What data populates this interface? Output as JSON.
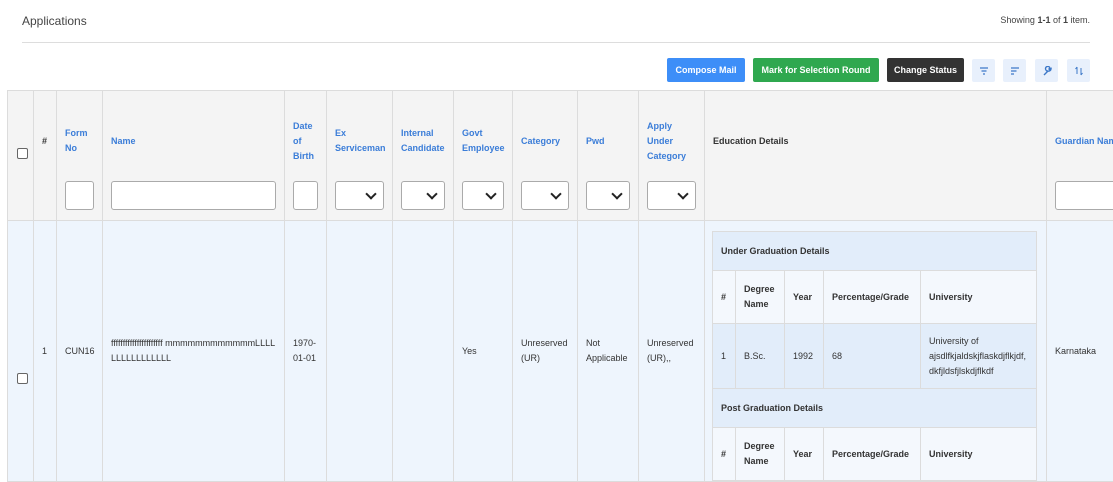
{
  "page": {
    "title": "Applications",
    "summary_prefix": "Showing ",
    "summary_range": "1-1",
    "summary_of": " of ",
    "summary_total": "1",
    "summary_suffix": " item."
  },
  "toolbar": {
    "compose_mail": "Compose Mail",
    "mark_selection": "Mark for Selection Round",
    "change_status": "Change Status"
  },
  "columns": {
    "num": "#",
    "form_no": "Form No",
    "name": "Name",
    "dob": "Date of Birth",
    "ex_serviceman": "Ex Serviceman",
    "internal_candidate": "Internal Candidate",
    "govt_employee": "Govt Employee",
    "category": "Category",
    "pwd": "Pwd",
    "apply_under_category": "Apply Under Category",
    "education_details": "Education Details",
    "guardian_name": "Guardian Name"
  },
  "row": {
    "num": "1",
    "form_no": "CUN16",
    "name": "ffffffffffffffffffffff mmmmmmmmmmmmLLLLLLLLLLLLLLLL",
    "dob": "1970-01-01",
    "ex_serviceman": "",
    "internal_candidate": "",
    "govt_employee": "Yes",
    "category": "Unreserved (UR)",
    "pwd": "Not Applicable",
    "apply_under_category": "Unreserved (UR),,",
    "guardian_name": "Karnataka"
  },
  "education": {
    "ug_title": "Under Graduation Details",
    "pg_title": "Post Graduation Details",
    "headers": {
      "num": "#",
      "degree": "Degree Name",
      "year": "Year",
      "grade": "Percentage/Grade",
      "university": "University"
    },
    "ug_row": {
      "num": "1",
      "degree": "B.Sc.",
      "year": "1992",
      "grade": "68",
      "university": "University of ajsdlfkjaldskjflaskdjflkjdf, dkfjldsfjlskdjflkdf"
    }
  }
}
